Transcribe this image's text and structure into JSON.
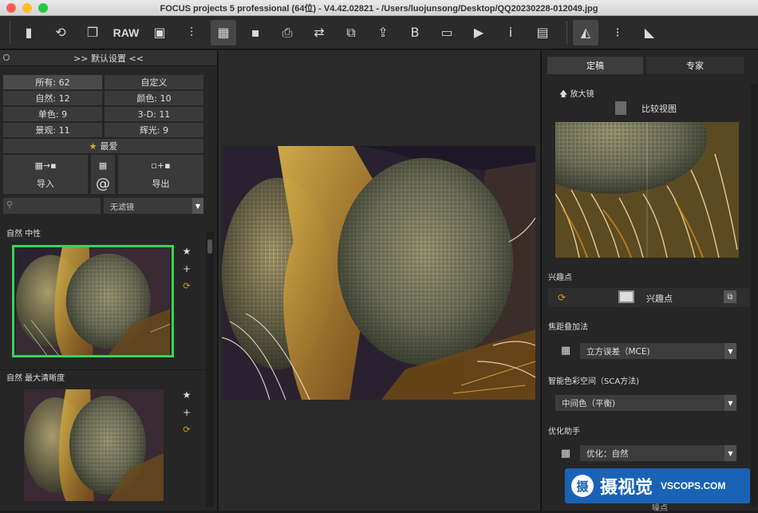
{
  "window": {
    "title": "FOCUS projects 5 professional (64位) - V4.42.02821 - /Users/luojunsong/Desktop/QQ20230228-012049.jpg",
    "lights": {
      "close": "#ff5f57",
      "min": "#febc2e",
      "max": "#28c840"
    }
  },
  "toolbar": {
    "items": [
      {
        "icon": "document-icon",
        "glyph": "▮"
      },
      {
        "icon": "history-icon",
        "glyph": "⟲"
      },
      {
        "icon": "copy-settings-icon",
        "glyph": "❐"
      },
      {
        "icon": "raw-icon",
        "glyph": "RAW"
      },
      {
        "icon": "images-icon",
        "glyph": "▣"
      },
      {
        "icon": "tools-icon",
        "glyph": "⫶"
      },
      {
        "icon": "presets-icon",
        "glyph": "▦"
      },
      {
        "icon": "save-icon",
        "glyph": "▪"
      },
      {
        "icon": "print-icon",
        "glyph": "⎙"
      },
      {
        "icon": "batch-icon",
        "glyph": "⇄"
      },
      {
        "icon": "export-icon",
        "glyph": "⧉"
      },
      {
        "icon": "share-icon",
        "glyph": "⇪"
      },
      {
        "icon": "bookmark-icon",
        "glyph": "B"
      },
      {
        "icon": "slideshow-icon",
        "glyph": "▭"
      },
      {
        "icon": "play-icon",
        "glyph": "▶"
      },
      {
        "icon": "info-icon",
        "glyph": "i"
      },
      {
        "icon": "histogram-icon",
        "glyph": "▤"
      },
      {
        "icon": "compare-icon",
        "glyph": "◭"
      },
      {
        "icon": "crop-icon",
        "glyph": "⁝"
      },
      {
        "icon": "flip-icon",
        "glyph": "◣"
      }
    ]
  },
  "left": {
    "header": ">> 默认设置 <<",
    "categories": [
      {
        "label": "所有: 62",
        "selected": true
      },
      {
        "label": "自定义"
      },
      {
        "label": "自然: 12"
      },
      {
        "label": "颜色: 10"
      },
      {
        "label": "单色: 9"
      },
      {
        "label": "3-D: 11"
      },
      {
        "label": "景观: 11"
      },
      {
        "label": "辉光: 9"
      }
    ],
    "favorites": "最爱",
    "import": "导入",
    "export": "导出",
    "at": "@",
    "filter_value": "无滤镜",
    "presets": [
      {
        "title": "自然 中性",
        "selected": true
      },
      {
        "title": "自然 最大清晰度"
      }
    ]
  },
  "right": {
    "tabs": [
      "定稿",
      "专家"
    ],
    "magnifier": "放大镜",
    "compare_view": "比较视图",
    "poi_section": "兴趣点",
    "poi_label": "兴趣点",
    "stack_section": "焦距叠加法",
    "stack_value": "立方误差（MCE)",
    "color_section": "智能色彩空间（SCA方法)",
    "color_value": "中间色（平衡)",
    "opt_section": "优化助手",
    "opt_value": "优化：自然",
    "bottom_label": "噪点"
  },
  "watermark": {
    "logo": "摄",
    "cn": "摄视觉",
    "en": "VSCOPS.COM"
  }
}
